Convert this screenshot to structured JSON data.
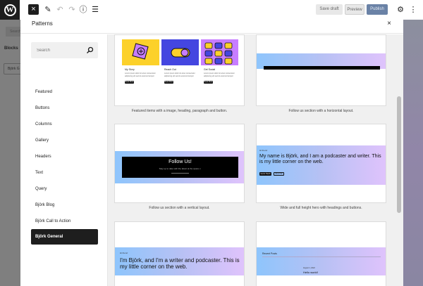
{
  "toolbar": {
    "close_label": "×",
    "save_draft": "Save draft",
    "preview": "Preview",
    "publish": "Publish",
    "icons": [
      "wordpress-icon",
      "close-icon",
      "pencil-icon",
      "undo-icon",
      "redo-icon",
      "info-icon",
      "list-view-icon",
      "gear-icon",
      "more-vertical-icon"
    ]
  },
  "inserter": {
    "search_placeholder": "Search",
    "tab_blocks": "Blocks",
    "item_label": "Björk G"
  },
  "modal": {
    "title": "Patterns",
    "close_label": "×",
    "search_placeholder": "Search",
    "categories": [
      {
        "label": "Featured"
      },
      {
        "label": "Buttons"
      },
      {
        "label": "Columns"
      },
      {
        "label": "Gallery"
      },
      {
        "label": "Headers"
      },
      {
        "label": "Text"
      },
      {
        "label": "Query"
      },
      {
        "label": "Björk Blog"
      },
      {
        "label": "Björk Call to Action"
      },
      {
        "label": "Björk General",
        "active": true
      }
    ]
  },
  "patterns": [
    {
      "caption": "Featured items with a image, heading, paragraph and button.",
      "columns": [
        {
          "title": "My Story",
          "text": "Lorem ipsum dolor sit amet consectetur adipiscing elit sed do eiusmod tempor",
          "button": "Read More"
        },
        {
          "title": "Reach Out",
          "text": "Lorem ipsum dolor sit amet consectetur adipiscing elit sed do eiusmod tempor",
          "button": "Read More"
        },
        {
          "title": "Get Social",
          "text": "Lorem ipsum dolor sit amet consectetur adipiscing elit sed do eiusmod tempor",
          "button": "Read More"
        }
      ]
    },
    {
      "caption": "Follow us section with a horizontal layout."
    },
    {
      "caption": "Follow us section with a vertical layout.",
      "heading": "Follow Us!",
      "text": "Stay up to date with the latest at the space x."
    },
    {
      "caption": "Wide and full height hero with headings and buttons.",
      "kicker": "Hi there!",
      "heading": "My name is Björk, and I am a podcaster and writer. This is my little corner on the web.",
      "buttons": [
        "Get in Touch",
        "About Me"
      ]
    },
    {
      "kicker": "Hi there!",
      "heading": "I'm Björk, and I'm a writer and podcaster. This is my little corner on the web."
    },
    {
      "title": "Recent Posts",
      "date": "August 1, 2022",
      "post_title": "Hello world!"
    }
  ],
  "colors": {
    "accent": "#1e1e1e",
    "gradient_start": "#8ec5fc",
    "gradient_end": "#e0c3fc",
    "card1_yellow": "#fcd12a",
    "card1_blue": "#4446e0",
    "card1_purple": "#c77dff"
  }
}
